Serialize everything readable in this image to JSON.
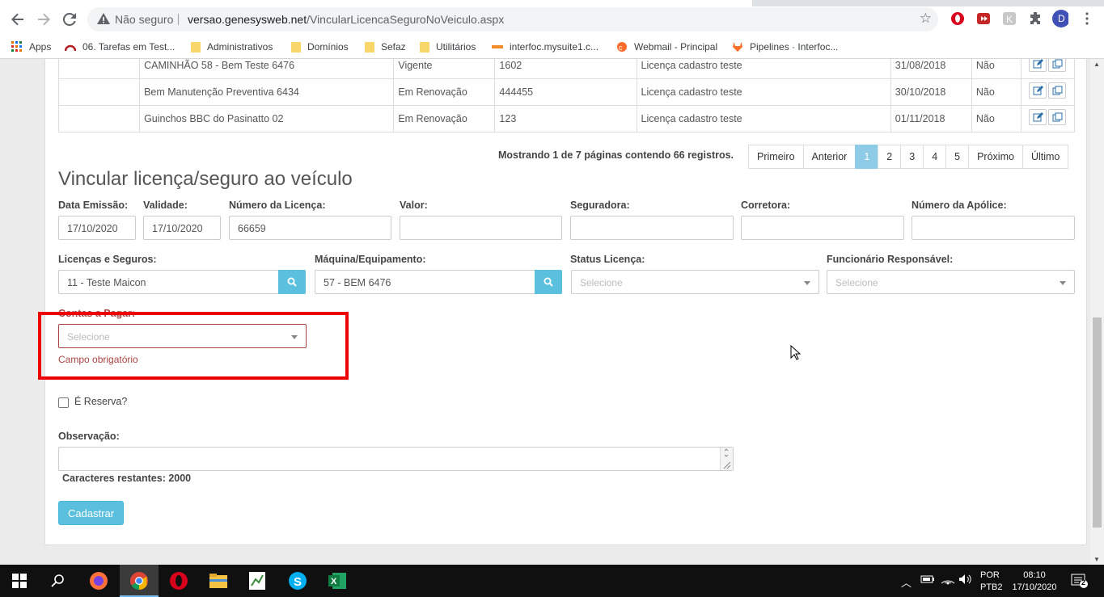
{
  "browser": {
    "security_label": "Não seguro",
    "url_host": "versao.genesysweb.net",
    "url_path": "/VincularLicencaSeguroNoVeiculo.aspx",
    "profile_initial": "D"
  },
  "bookmarks": [
    {
      "label": "Apps",
      "icon": "apps-grid-icon"
    },
    {
      "label": "06. Tarefas em Test...",
      "icon": "redmine-icon"
    },
    {
      "label": "Administrativos",
      "icon": "folder-icon"
    },
    {
      "label": "Domínios",
      "icon": "folder-icon"
    },
    {
      "label": "Sefaz",
      "icon": "folder-icon"
    },
    {
      "label": "Utilitários",
      "icon": "folder-icon"
    },
    {
      "label": "interfoc.mysuite1.c...",
      "icon": "mysuite-icon"
    },
    {
      "label": "Webmail - Principal",
      "icon": "cpanel-icon"
    },
    {
      "label": "Pipelines · Interfoc...",
      "icon": "gitlab-icon"
    }
  ],
  "table": {
    "rows": [
      {
        "vehicle": "CAMINHÃO 58 - Bem Teste 6476",
        "status": "Vigente",
        "number": "1602",
        "license": "Licença cadastro teste",
        "date": "31/08/2018",
        "reserve": "Não"
      },
      {
        "vehicle": "Bem Manutenção Preventiva 6434",
        "status": "Em Renovação",
        "number": "444455",
        "license": "Licença cadastro teste",
        "date": "30/10/2018",
        "reserve": "Não"
      },
      {
        "vehicle": "Guinchos BBC do Pasinatto 02",
        "status": "Em Renovação",
        "number": "123",
        "license": "Licença cadastro teste",
        "date": "01/11/2018",
        "reserve": "Não"
      }
    ]
  },
  "pagination": {
    "summary": "Mostrando 1 de 7 páginas contendo 66 registros.",
    "first": "Primeiro",
    "prev": "Anterior",
    "pages": [
      "1",
      "2",
      "3",
      "4",
      "5"
    ],
    "active_page": "1",
    "next": "Próximo",
    "last": "Último"
  },
  "form": {
    "title": "Vincular licença/seguro ao veículo",
    "data_emissao_label": "Data Emissão:",
    "data_emissao_value": "17/10/2020",
    "validade_label": "Validade:",
    "validade_value": "17/10/2020",
    "numero_licenca_label": "Número da Licença:",
    "numero_licenca_value": "66659",
    "valor_label": "Valor:",
    "seguradora_label": "Seguradora:",
    "corretora_label": "Corretora:",
    "numero_apolice_label": "Número da Apólice:",
    "licencas_label": "Licenças e Seguros:",
    "licencas_value": "11 - Teste Maicon",
    "maquina_label": "Máquina/Equipamento:",
    "maquina_value": "57 - BEM 6476",
    "status_label": "Status Licença:",
    "status_placeholder": "Selecione",
    "funcionario_label": "Funcionário Responsável:",
    "funcionario_placeholder": "Selecione",
    "contas_label": "Contas a Pagar:",
    "contas_placeholder": "Selecione",
    "contas_error": "Campo obrigatório",
    "reserva_label": "É Reserva?",
    "observacao_label": "Observação:",
    "caracteres_label": "Caracteres restantes: 2000",
    "submit_label": "Cadastrar"
  },
  "taskbar": {
    "lang_top": "POR",
    "lang_bottom": "PTB2",
    "time": "08:10",
    "date": "17/10/2020",
    "notifications": "2"
  },
  "colors": {
    "accent": "#5bc0de",
    "error": "#a94442",
    "highlight_box": "#ee0000"
  }
}
